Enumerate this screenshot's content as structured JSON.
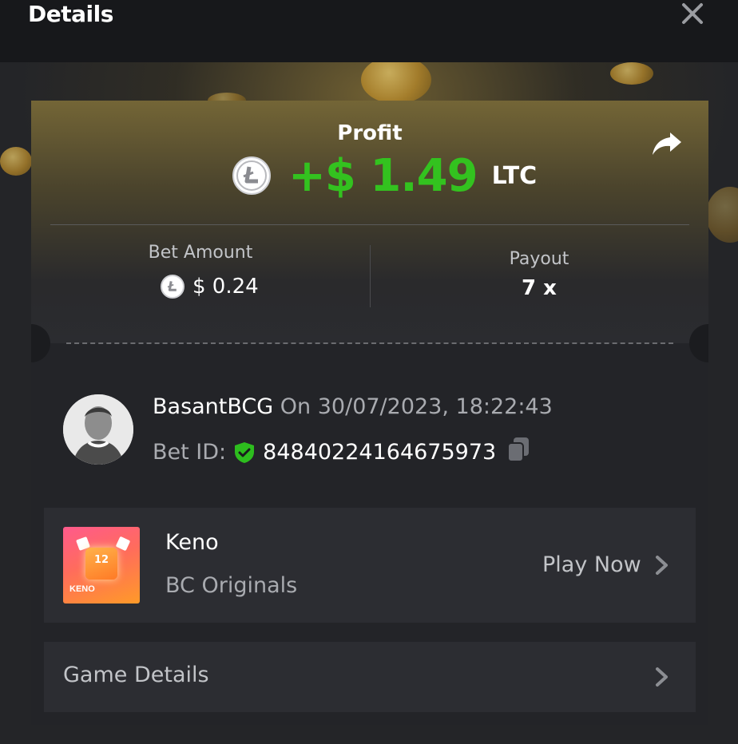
{
  "header": {
    "title": "Details"
  },
  "profit": {
    "label": "Profit",
    "value": "+$ 1.49",
    "unit": "LTC",
    "color": "#33c21f"
  },
  "bet_amount": {
    "label": "Bet Amount",
    "value": "$ 0.24"
  },
  "payout": {
    "label": "Payout",
    "value": "7 x"
  },
  "user": {
    "name": "BasantBCG",
    "date_text": "On 30/07/2023, 18:22:43"
  },
  "bet_id": {
    "label": "Bet ID:",
    "value": "84840224164675973"
  },
  "game": {
    "name": "Keno",
    "provider": "BC Originals",
    "play_label": "Play Now",
    "thumb_number": "12",
    "thumb_label": "KENO"
  },
  "game_details": {
    "label": "Game Details"
  },
  "icons": [
    "close-icon",
    "share-icon",
    "litecoin-icon",
    "shield-check-icon",
    "copy-icon",
    "chevron-right-icon"
  ],
  "colors": {
    "accent_green": "#33c21f",
    "panel": "#2c2d32",
    "background": "#232529"
  }
}
